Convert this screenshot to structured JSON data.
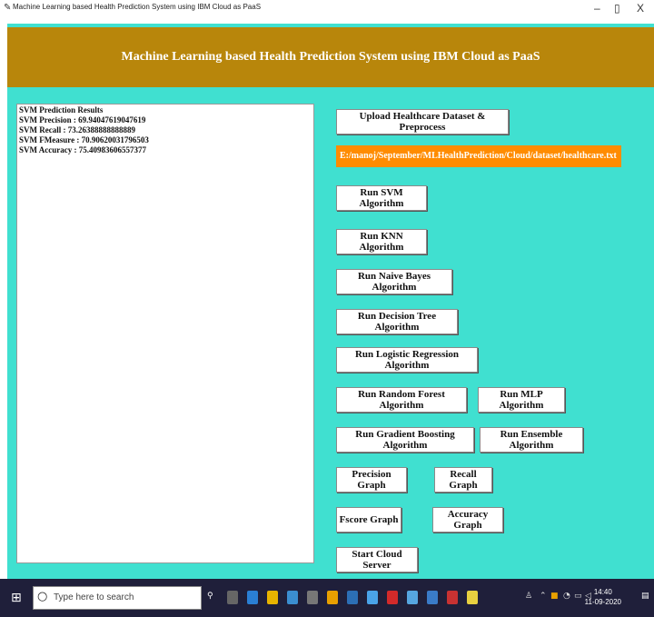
{
  "window": {
    "title": "Machine Learning based Health Prediction System using IBM Cloud as PaaS",
    "minimize": "–",
    "maximize": "▯",
    "close": "X"
  },
  "header": {
    "title": "Machine Learning based Health Prediction System using IBM Cloud as PaaS"
  },
  "results": {
    "lines": [
      "SVM Prediction Results",
      "SVM Precision : 69.94047619047619",
      "SVM Recall : 73.26388888888889",
      "SVM FMeasure : 70.90620031796503",
      "SVM Accuracy : 75.40983606557377"
    ]
  },
  "buttons": {
    "upload": "Upload Healthcare Dataset & Preprocess",
    "svm": "Run SVM Algorithm",
    "knn": "Run KNN Algorithm",
    "naive_bayes": "Run Naive Bayes Algorithm",
    "decision_tree": "Run Decision Tree Algorithm",
    "logistic": "Run Logistic Regression Algorithm",
    "random_forest": "Run Random Forest Algorithm",
    "mlp": "Run MLP Algorithm",
    "gradient_boosting": "Run Gradient Boosting Algorithm",
    "ensemble": "Run Ensemble Algorithm",
    "precision_graph": "Precision Graph",
    "recall_graph": "Recall Graph",
    "fscore_graph": "Fscore Graph",
    "accuracy_graph": "Accuracy Graph",
    "cloud_server": "Start Cloud Server"
  },
  "dataset_path": "E:/manoj/September/MLHealthPrediction/Cloud/dataset/healthcare.txt",
  "taskbar": {
    "search_placeholder": "Type here to search",
    "time": "14:40",
    "date": "11-09-2020"
  },
  "colors": {
    "client_bg": "#40E0D0",
    "header_bg": "#B8860B",
    "path_bg": "#FF8C00",
    "taskbar_bg": "#1f1f3a"
  }
}
